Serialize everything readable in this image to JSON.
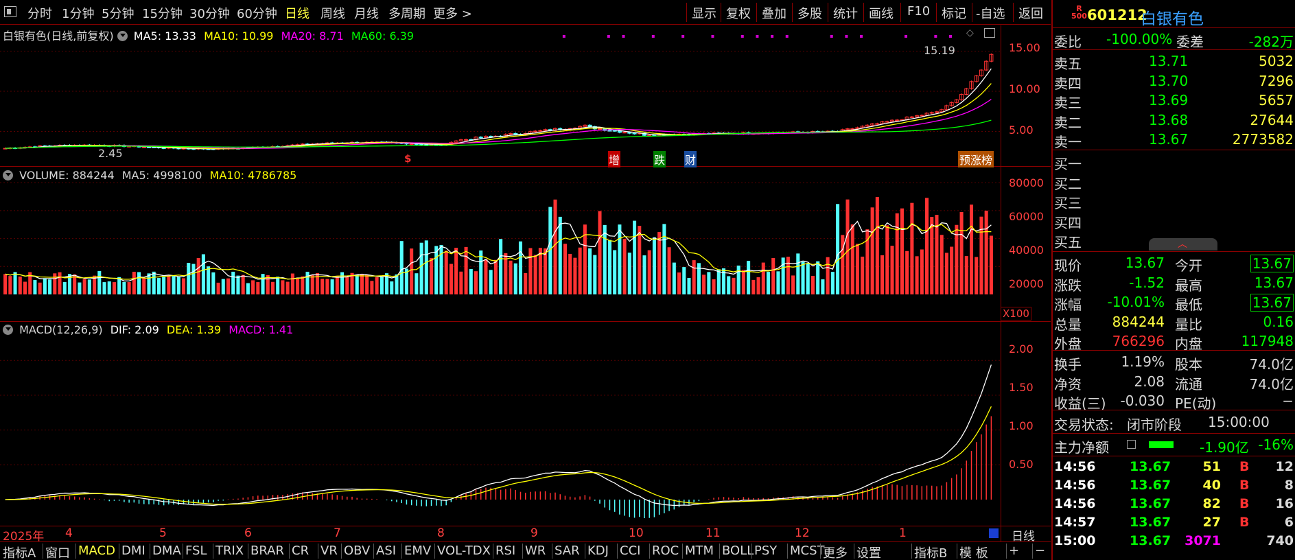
{
  "toolbar": {
    "periods": [
      "分时",
      "1分钟",
      "5分钟",
      "15分钟",
      "30分钟",
      "60分钟",
      "日线",
      "周线",
      "月线",
      "多周期",
      "更多 >"
    ],
    "active_period": "日线",
    "actions": [
      "显示",
      "复权",
      "叠加",
      "多股",
      "统计",
      "画线",
      "F10",
      "标记",
      "-自选",
      "返回"
    ]
  },
  "kline_panel": {
    "title": "白银有色(日线,前复权)",
    "ma5": "MA5: 13.33",
    "ma10": "MA10: 10.99",
    "ma20": "MA20: 8.71",
    "ma60": "MA60: 6.39",
    "y_labels": [
      "15.00",
      "10.00",
      "5.00"
    ],
    "high_label": "15.19",
    "low_label": "2.45",
    "markers": [
      "$",
      "增",
      "跌",
      "财"
    ],
    "tag": "预涨榜"
  },
  "volume_panel": {
    "title": "VOLUME: 884244",
    "ma5": "MA5: 4998100",
    "ma10": "MA10: 4786785",
    "y_labels": [
      "80000",
      "60000",
      "40000",
      "20000"
    ],
    "unit": "X100"
  },
  "macd_panel": {
    "title": "MACD(12,26,9)",
    "dif": "DIF: 2.09",
    "dea": "DEA: 1.39",
    "macd": "MACD: 1.41",
    "y_labels": [
      "2.00",
      "1.50",
      "1.00",
      "0.50"
    ]
  },
  "x_axis": {
    "year": "2025年",
    "months": [
      "4",
      "5",
      "6",
      "7",
      "8",
      "9",
      "10",
      "11",
      "12",
      "1"
    ],
    "period_label": "日线"
  },
  "bottom_tabs": [
    "指标A",
    "窗口",
    "MACD",
    "DMI",
    "DMA",
    "FSL",
    "TRIX",
    "BRAR",
    "CR",
    "VR",
    "OBV",
    "ASI",
    "EMV",
    "VOL-TDX",
    "RSI",
    "WR",
    "SAR",
    "KDJ",
    "CCI",
    "ROC",
    "MTM",
    "BOLL",
    "PSY",
    "MCST",
    "更多",
    "设置",
    "指标B",
    "模 板",
    "+",
    "−"
  ],
  "active_tab": "MACD",
  "stock": {
    "badge_top": "R",
    "badge_bottom": "500",
    "code": "601212",
    "name": "白银有色"
  },
  "order_book": {
    "weibi_label": "委比",
    "weibi": "-100.00%",
    "weicha_label": "委差",
    "weicha": "-282万",
    "sells": [
      {
        "label": "卖五",
        "price": "13.71",
        "vol": "5032"
      },
      {
        "label": "卖四",
        "price": "13.70",
        "vol": "7296"
      },
      {
        "label": "卖三",
        "price": "13.69",
        "vol": "5657"
      },
      {
        "label": "卖二",
        "price": "13.68",
        "vol": "27644"
      },
      {
        "label": "卖一",
        "price": "13.67",
        "vol": "2773582"
      }
    ],
    "buys": [
      "买一",
      "买二",
      "买三",
      "买四",
      "买五"
    ]
  },
  "quote": [
    {
      "l1": "现价",
      "v1": "13.67",
      "l2": "今开",
      "v2": "13.67"
    },
    {
      "l1": "涨跌",
      "v1": "-1.52",
      "l2": "最高",
      "v2": "13.67"
    },
    {
      "l1": "涨幅",
      "v1": "-10.01%",
      "l2": "最低",
      "v2": "13.67"
    },
    {
      "l1": "总量",
      "v1": "884244",
      "l2": "量比",
      "v2": "0.16"
    },
    {
      "l1": "外盘",
      "v1": "766296",
      "l2": "内盘",
      "v2": "117948"
    }
  ],
  "fundamentals": [
    {
      "l1": "换手",
      "v1": "1.19%",
      "l2": "股本",
      "v2": "74.0亿"
    },
    {
      "l1": "净资",
      "v1": "2.08",
      "l2": "流通",
      "v2": "74.0亿"
    },
    {
      "l1": "收益(三)",
      "v1": "-0.030",
      "l2": "PE(动)",
      "v2": "−"
    }
  ],
  "status": {
    "label": "交易状态:",
    "value": "闭市阶段",
    "time": "15:00:00"
  },
  "main_flow": {
    "label": "主力净额",
    "value": "-1.90亿",
    "pct": "-16%"
  },
  "ticks": [
    {
      "time": "14:56",
      "price": "13.67",
      "vol": "51",
      "side": "B",
      "num": "12"
    },
    {
      "time": "14:56",
      "price": "13.67",
      "vol": "40",
      "side": "B",
      "num": "8"
    },
    {
      "time": "14:56",
      "price": "13.67",
      "vol": "82",
      "side": "B",
      "num": "16"
    },
    {
      "time": "14:57",
      "price": "13.67",
      "vol": "27",
      "side": "B",
      "num": "6"
    },
    {
      "time": "15:00",
      "price": "13.67",
      "vol": "3071",
      "side": "",
      "num": "740"
    }
  ],
  "colors": {
    "up": "#ff3232",
    "down": "#54ffff",
    "ma5": "#ffffff",
    "ma10": "#ffff00",
    "ma20": "#ff00ff",
    "ma60": "#00ff00",
    "axis": "#8b0000",
    "price_green": "#00ff00"
  }
}
